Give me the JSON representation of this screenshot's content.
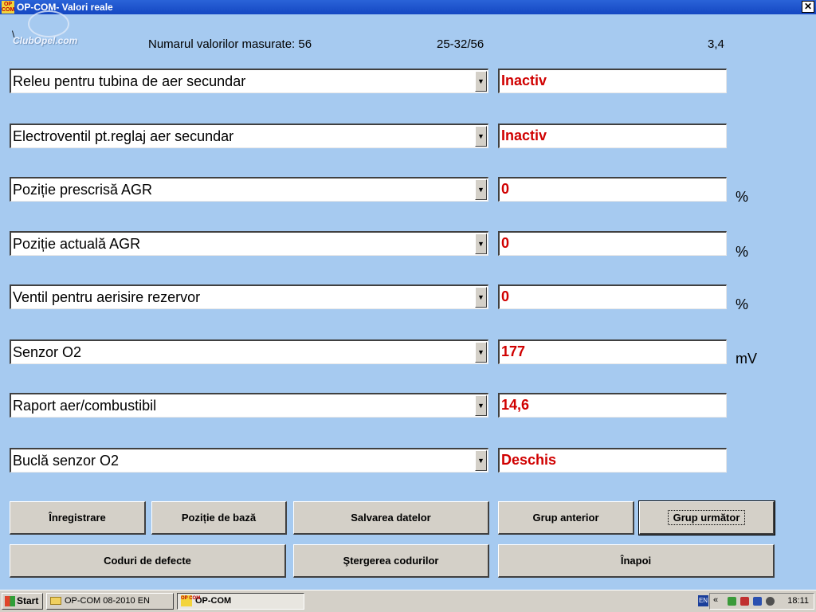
{
  "window": {
    "app_icon_text": "OP COM",
    "title": "OP-COM- Valori reale",
    "close_glyph": "✕"
  },
  "header": {
    "logo_mark": "\\",
    "logo": "ClubOpel.com",
    "measured_label": "Numarul valorilor masurate: 56",
    "range": "25-32/56",
    "version": "3,4"
  },
  "rows": [
    {
      "label": "Releu pentru tubina de aer secundar",
      "value": "Inactiv",
      "unit": ""
    },
    {
      "label": "Electroventil pt.reglaj aer secundar",
      "value": "Inactiv",
      "unit": ""
    },
    {
      "label": "Poziție prescrisă AGR",
      "value": "0",
      "unit": "%"
    },
    {
      "label": "Poziție actuală AGR",
      "value": "0",
      "unit": "%"
    },
    {
      "label": "Ventil pentru aerisire rezervor",
      "value": "0",
      "unit": "%"
    },
    {
      "label": "Senzor O2",
      "value": "177",
      "unit": "mV"
    },
    {
      "label": "Raport aer/combustibil",
      "value": "14,6",
      "unit": ""
    },
    {
      "label": "Buclă senzor O2",
      "value": "Deschis",
      "unit": ""
    }
  ],
  "buttons": {
    "record": "Înregistrare",
    "base_position": "Poziție de bază",
    "save_data": "Salvarea datelor",
    "previous_group": "Grup anterior",
    "next_group": "Grup următor",
    "fault_codes": "Coduri de defecte",
    "clear_codes": "Ştergerea codurilor",
    "back": "Înapoi"
  },
  "taskbar": {
    "start": "Start",
    "item1": "OP-COM 08-2010 EN",
    "item2": "OP-COM",
    "lang": "EN",
    "chevron": "«",
    "clock": "18:11"
  },
  "colors": {
    "background": "#a6caf0",
    "value_text": "#d00000",
    "titlebar": "#1447c2"
  }
}
